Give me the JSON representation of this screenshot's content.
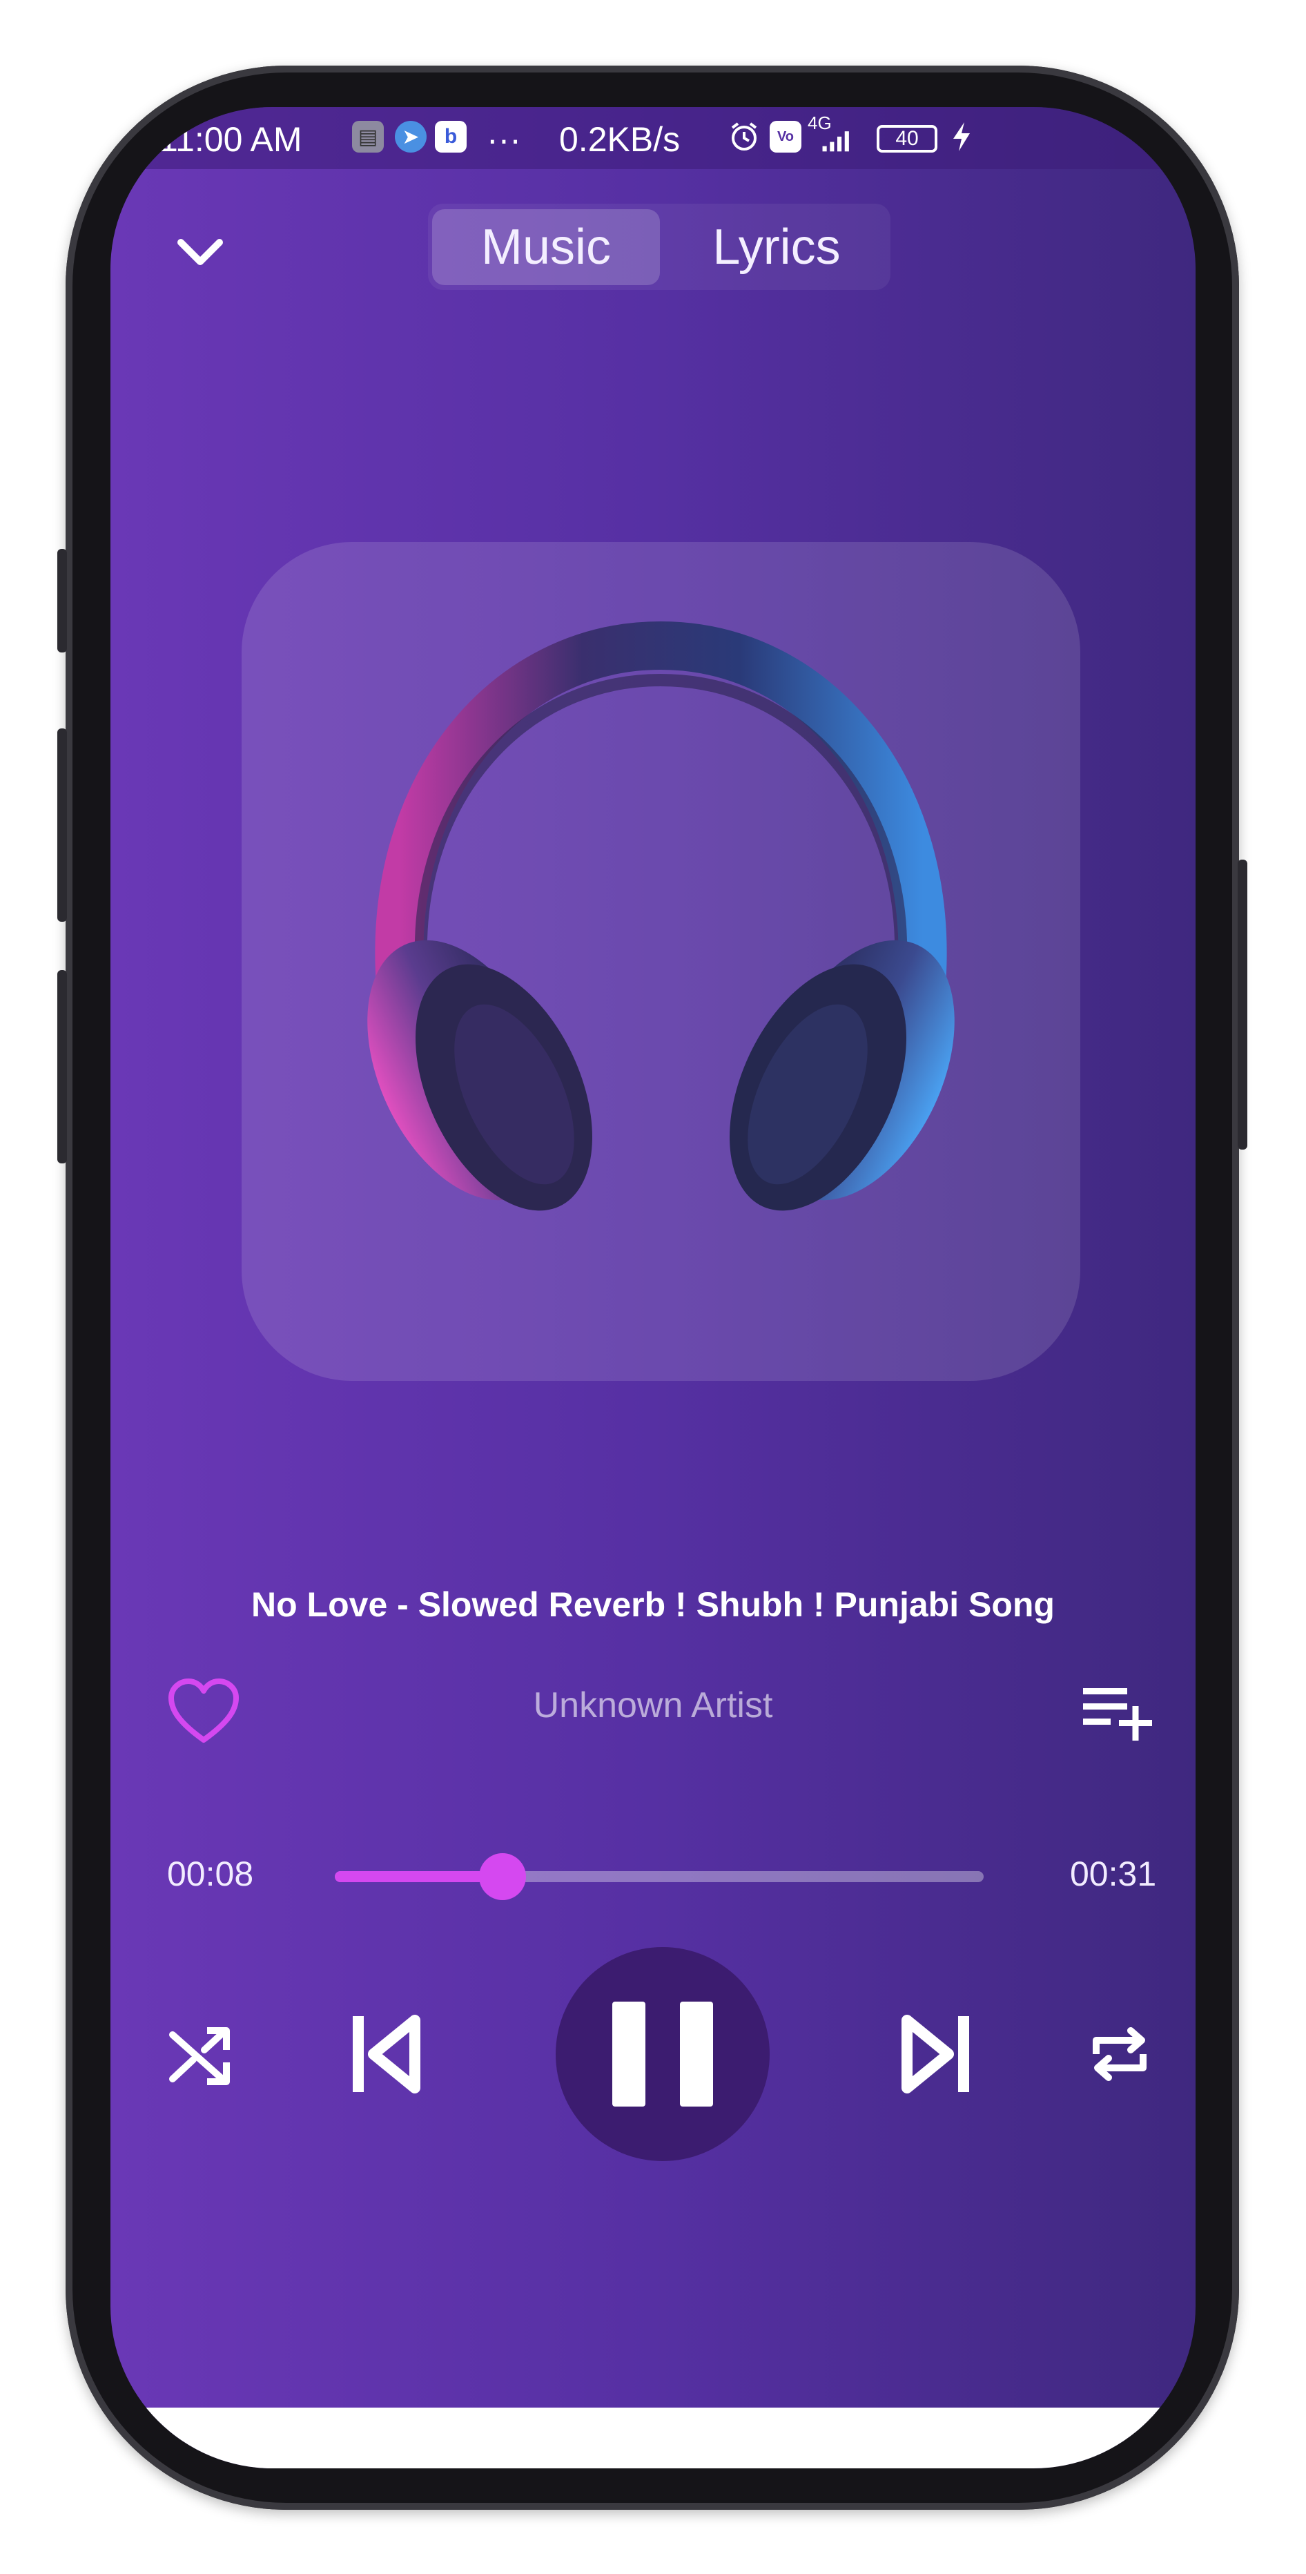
{
  "status_bar": {
    "time": "11:00 AM",
    "more": "···",
    "speed": "0.2KB/s",
    "network": "4G",
    "battery": "40"
  },
  "header": {
    "tabs": [
      {
        "label": "Music",
        "active": true
      },
      {
        "label": "Lyrics",
        "active": false
      }
    ]
  },
  "track": {
    "title": "No Love - Slowed Reverb ! Shubh ! Punjabi Song",
    "artist": "Unknown Artist",
    "favorite": false
  },
  "progress": {
    "elapsed": "00:08",
    "total": "00:31",
    "fraction": 0.258
  },
  "colors": {
    "accent": "#d548f0",
    "background_left": "#6a38b6",
    "background_right": "#3f287f",
    "play_button": "#3c1c70"
  },
  "controls": {
    "shuffle_icon": "shuffle-icon",
    "previous_icon": "skip-previous-icon",
    "play_state": "playing",
    "pause_icon": "pause-icon",
    "next_icon": "skip-next-icon",
    "repeat_icon": "repeat-icon"
  },
  "icons": {
    "collapse": "chevron-down-icon",
    "favorite": "heart-outline-icon",
    "add_to_queue": "playlist-add-icon",
    "artwork": "headphones-image"
  }
}
